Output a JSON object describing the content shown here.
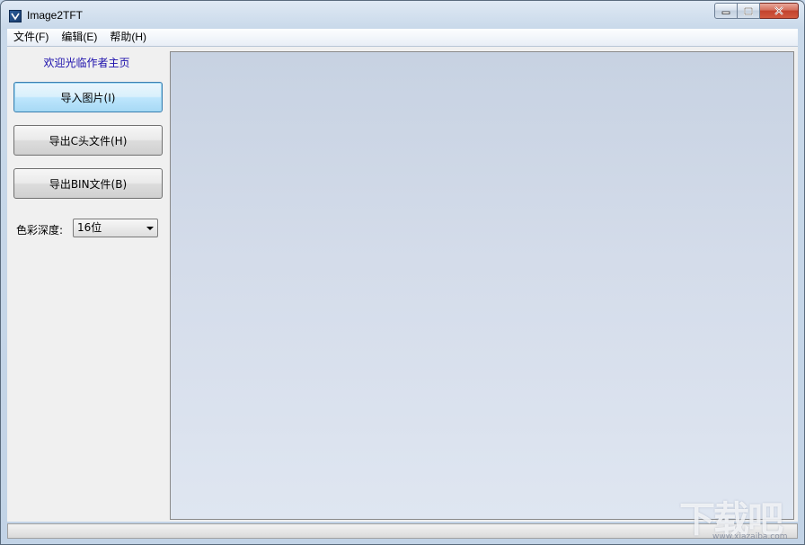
{
  "window": {
    "title": "Image2TFT"
  },
  "menu": {
    "items": [
      "文件(F)",
      "编辑(E)",
      "帮助(H)"
    ]
  },
  "sidebar": {
    "welcome_link": "欢迎光临作者主页",
    "buttons": {
      "import": "导入图片(I)",
      "export_c": "导出C头文件(H)",
      "export_bin": "导出BIN文件(B)"
    },
    "color_depth": {
      "label": "色彩深度:",
      "selected": "16位"
    }
  },
  "watermark": {
    "text": "下载吧",
    "url": "www.xiazaiba.com"
  },
  "icons": {
    "app": "app-icon",
    "minimize": "minimize-icon",
    "maximize": "maximize-icon",
    "close": "close-icon",
    "dropdown": "chevron-down-icon"
  },
  "colors": {
    "link": "#1a0dab",
    "canvas_top": "#c7d2e2",
    "canvas_bottom": "#dfe6f1"
  }
}
